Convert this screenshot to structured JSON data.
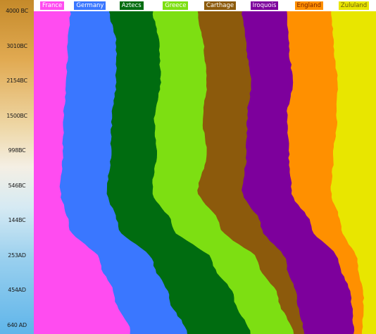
{
  "chart_data": {
    "type": "area",
    "stacked": true,
    "normalized": true,
    "orientation": "vertical-time-axis",
    "y_tick_labels": [
      "4000 BC",
      "3010BC",
      "2154BC",
      "1500BC",
      "998BC",
      "546BC",
      "144BC",
      "253AD",
      "454AD",
      "640 AD"
    ],
    "series": [
      {
        "name": "France",
        "color": "#ff4cf0",
        "values": [
          10.7,
          10.0,
          9.6,
          8.8,
          8.5,
          7.8,
          10.3,
          19.5,
          23.8,
          28.4
        ]
      },
      {
        "name": "Germany",
        "color": "#3a77ff",
        "values": [
          11.5,
          14.2,
          14.5,
          14.0,
          14.1,
          13.6,
          14.3,
          15.5,
          15.9,
          16.4
        ]
      },
      {
        "name": "Aztecs",
        "color": "#006c10",
        "values": [
          12.7,
          12.6,
          13.0,
          12.5,
          13.3,
          13.3,
          15.9,
          17.4,
          18.9,
          18.5
        ]
      },
      {
        "name": "Greece",
        "color": "#7ddf12",
        "values": [
          13.0,
          12.9,
          13.5,
          14.1,
          14.8,
          13.3,
          14.1,
          13.2,
          12.9,
          12.6
        ]
      },
      {
        "name": "Carthage",
        "color": "#8c5a0c",
        "values": [
          13.0,
          12.5,
          13.0,
          13.0,
          11.5,
          13.0,
          11.9,
          8.2,
          5.4,
          3.1
        ]
      },
      {
        "name": "Iroquois",
        "color": "#7d009c",
        "values": [
          13.0,
          12.5,
          12.1,
          11.6,
          12.4,
          14.3,
          14.6,
          15.5,
          16.0,
          14.6
        ]
      },
      {
        "name": "England",
        "color": "#ff9000",
        "values": [
          13.1,
          13.1,
          13.1,
          14.6,
          13.1,
          11.6,
          8.7,
          5.4,
          3.5,
          2.5
        ]
      },
      {
        "name": "Zululand",
        "color": "#e8e600",
        "values": [
          13.0,
          12.2,
          11.2,
          11.4,
          12.3,
          13.1,
          10.2,
          5.3,
          3.6,
          3.9
        ]
      }
    ]
  }
}
